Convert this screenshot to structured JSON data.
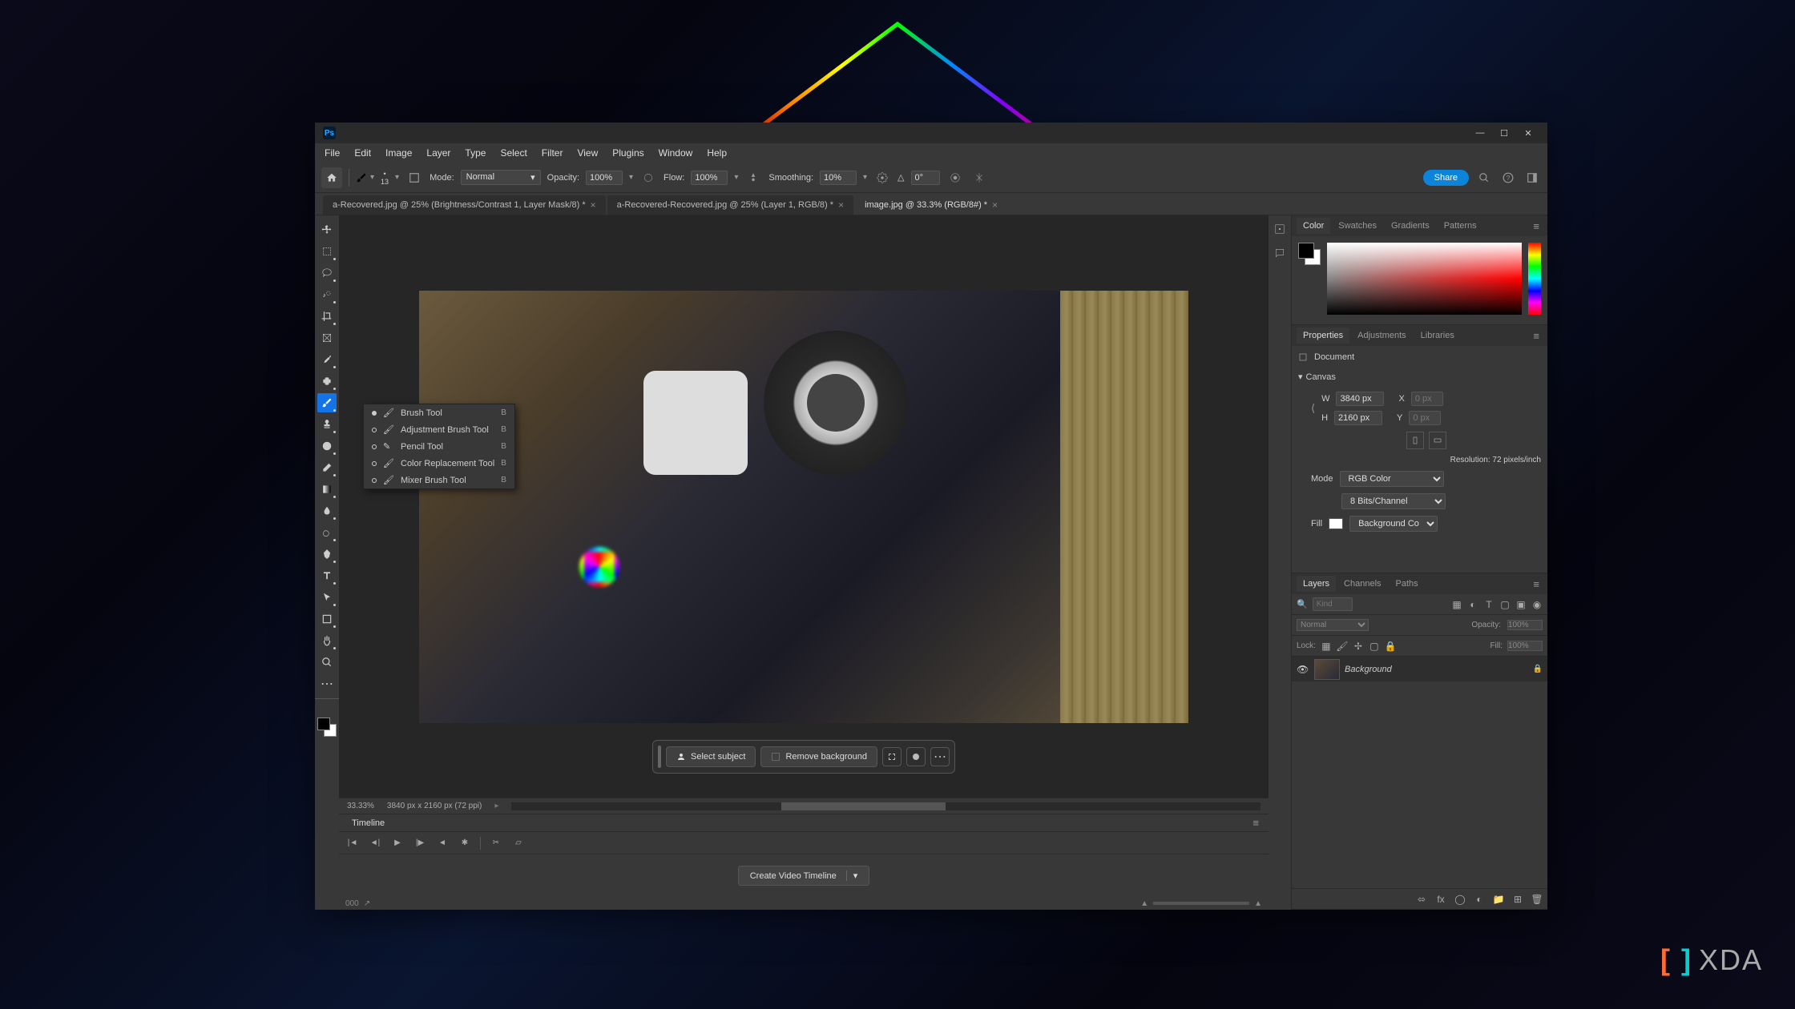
{
  "menubar": [
    "File",
    "Edit",
    "Image",
    "Layer",
    "Type",
    "Select",
    "Filter",
    "View",
    "Plugins",
    "Window",
    "Help"
  ],
  "options": {
    "brush_size": "13",
    "mode_label": "Mode:",
    "mode_value": "Normal",
    "opacity_label": "Opacity:",
    "opacity_value": "100%",
    "flow_label": "Flow:",
    "flow_value": "100%",
    "smoothing_label": "Smoothing:",
    "smoothing_value": "10%",
    "angle_label": "△",
    "angle_value": "0°",
    "share": "Share"
  },
  "tabs": [
    {
      "label": "a-Recovered.jpg @ 25% (Brightness/Contrast 1, Layer Mask/8) *",
      "active": false
    },
    {
      "label": "a-Recovered-Recovered.jpg @ 25% (Layer 1, RGB/8) *",
      "active": false
    },
    {
      "label": "image.jpg @ 33.3% (RGB/8#) *",
      "active": true
    }
  ],
  "brush_flyout": [
    {
      "label": "Brush Tool",
      "key": "B",
      "selected": true
    },
    {
      "label": "Adjustment Brush Tool",
      "key": "B",
      "selected": false
    },
    {
      "label": "Pencil Tool",
      "key": "B",
      "selected": false
    },
    {
      "label": "Color Replacement Tool",
      "key": "B",
      "selected": false
    },
    {
      "label": "Mixer Brush Tool",
      "key": "B",
      "selected": false
    }
  ],
  "context_bar": {
    "select_subject": "Select subject",
    "remove_bg": "Remove background"
  },
  "status": {
    "zoom": "33.33%",
    "dims": "3840 px x 2160 px (72 ppi)"
  },
  "timeline": {
    "title": "Timeline",
    "create_btn": "Create Video Timeline"
  },
  "panels": {
    "color_tabs": [
      "Color",
      "Swatches",
      "Gradients",
      "Patterns"
    ],
    "props_tabs": [
      "Properties",
      "Adjustments",
      "Libraries"
    ],
    "layers_tabs": [
      "Layers",
      "Channels",
      "Paths"
    ]
  },
  "properties": {
    "doc_label": "Document",
    "section": "Canvas",
    "w_label": "W",
    "w_value": "3840 px",
    "x_label": "X",
    "x_value": "0 px",
    "h_label": "H",
    "h_value": "2160 px",
    "y_label": "Y",
    "y_value": "0 px",
    "resolution": "Resolution: 72   pixels/inch",
    "mode_label": "Mode",
    "mode_value": "RGB Color",
    "bits_value": "8 Bits/Channel",
    "fill_label": "Fill",
    "fill_value": "Background Color"
  },
  "layers": {
    "search_placeholder": "Kind",
    "blend_mode": "Normal",
    "opacity_label": "Opacity:",
    "opacity_value": "100%",
    "lock_label": "Lock:",
    "fill_label": "Fill:",
    "fill_value": "100%",
    "layer_name": "Background"
  },
  "xda": "XDA"
}
